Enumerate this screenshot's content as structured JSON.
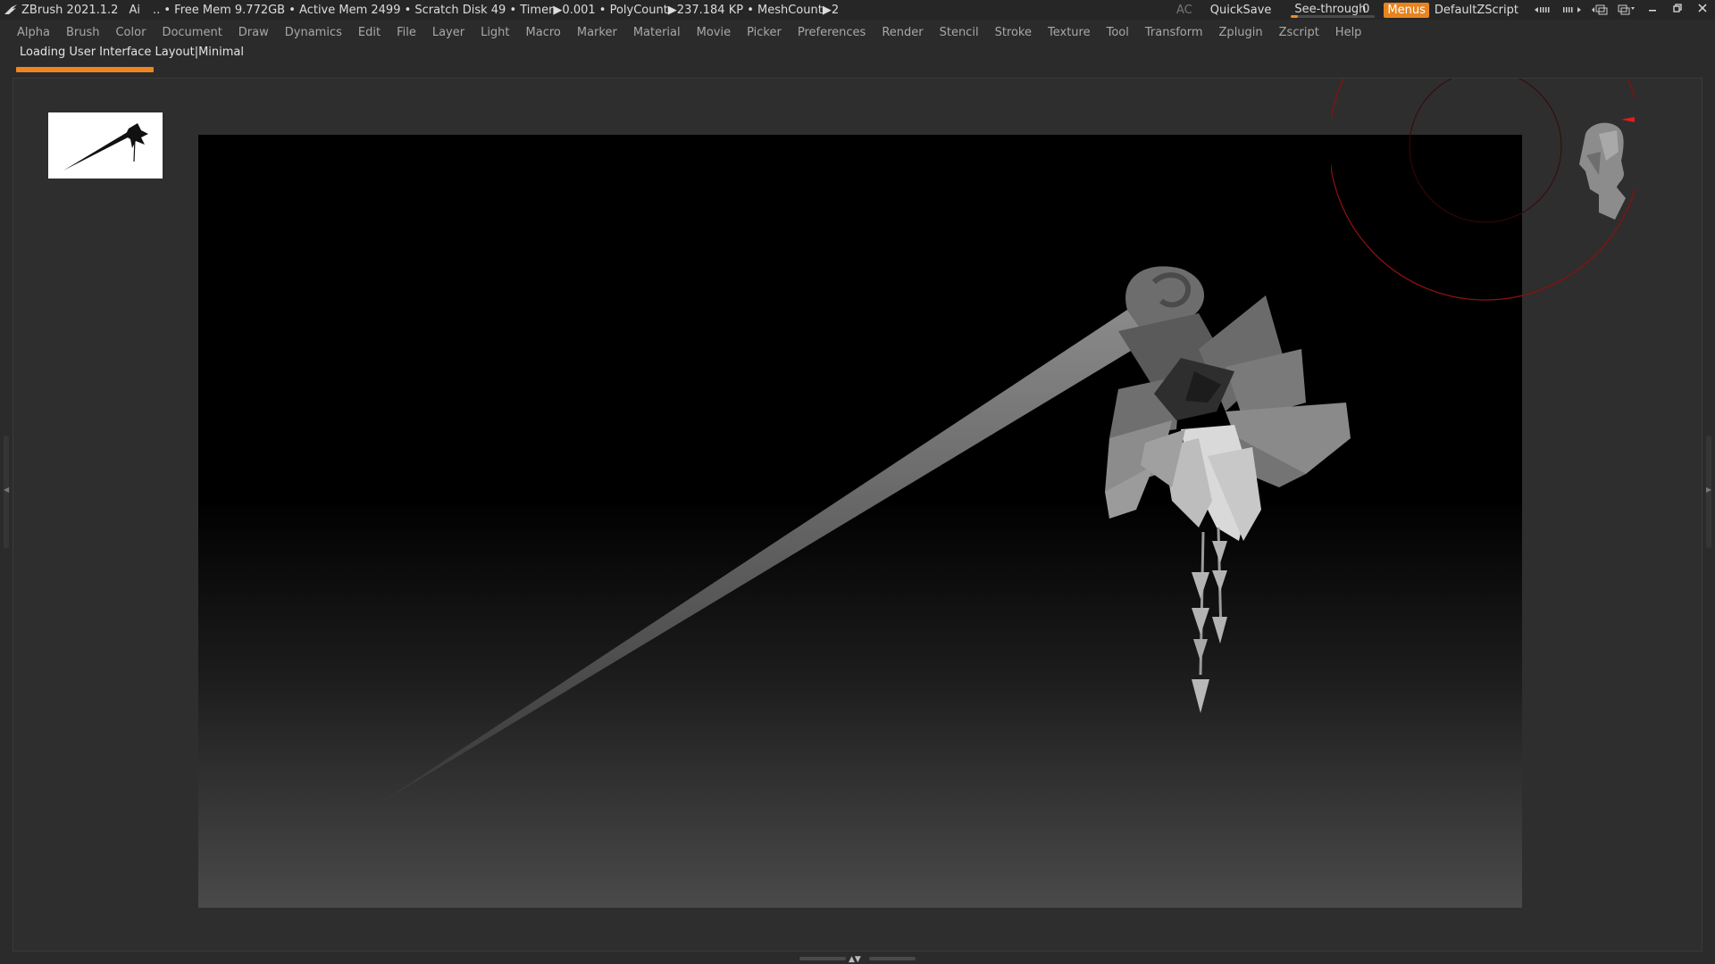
{
  "titlebar": {
    "app_title": "ZBrush 2021.1.2",
    "ai_label": "Ai",
    "stats": ".. • Free Mem 9.772GB • Active Mem 2499 • Scratch Disk 49 •  Timer▶0.001 • PolyCount▶237.184 KP  • MeshCount▶2",
    "ac_label": "AC",
    "quicksave_label": "QuickSave",
    "seethrough_label": "See-through",
    "seethrough_value": "0",
    "menus_label": "Menus",
    "default_zscript_label": "DefaultZScript",
    "colors": {
      "accent": "#e8841f",
      "titlebar_bg": "#262626"
    }
  },
  "menubar": {
    "items": [
      "Alpha",
      "Brush",
      "Color",
      "Document",
      "Draw",
      "Dynamics",
      "Edit",
      "File",
      "Layer",
      "Light",
      "Macro",
      "Marker",
      "Material",
      "Movie",
      "Picker",
      "Preferences",
      "Render",
      "Stencil",
      "Stroke",
      "Texture",
      "Tool",
      "Transform",
      "Zplugin",
      "Zscript",
      "Help"
    ]
  },
  "status": {
    "loading_text": "Loading User Interface Layout|Minimal",
    "progress": 0.08
  },
  "viewport": {
    "model": "hair-pin-with-flower",
    "navigator": "head-gizmo",
    "axis_colors": {
      "x": "#e21d1d",
      "y": "#1ed33b",
      "z": "#1c3cf0"
    }
  },
  "icons": {
    "logo": "zbrush-logo-icon",
    "minimize": "minimize-icon",
    "restore": "restore-icon",
    "close": "close-icon"
  }
}
